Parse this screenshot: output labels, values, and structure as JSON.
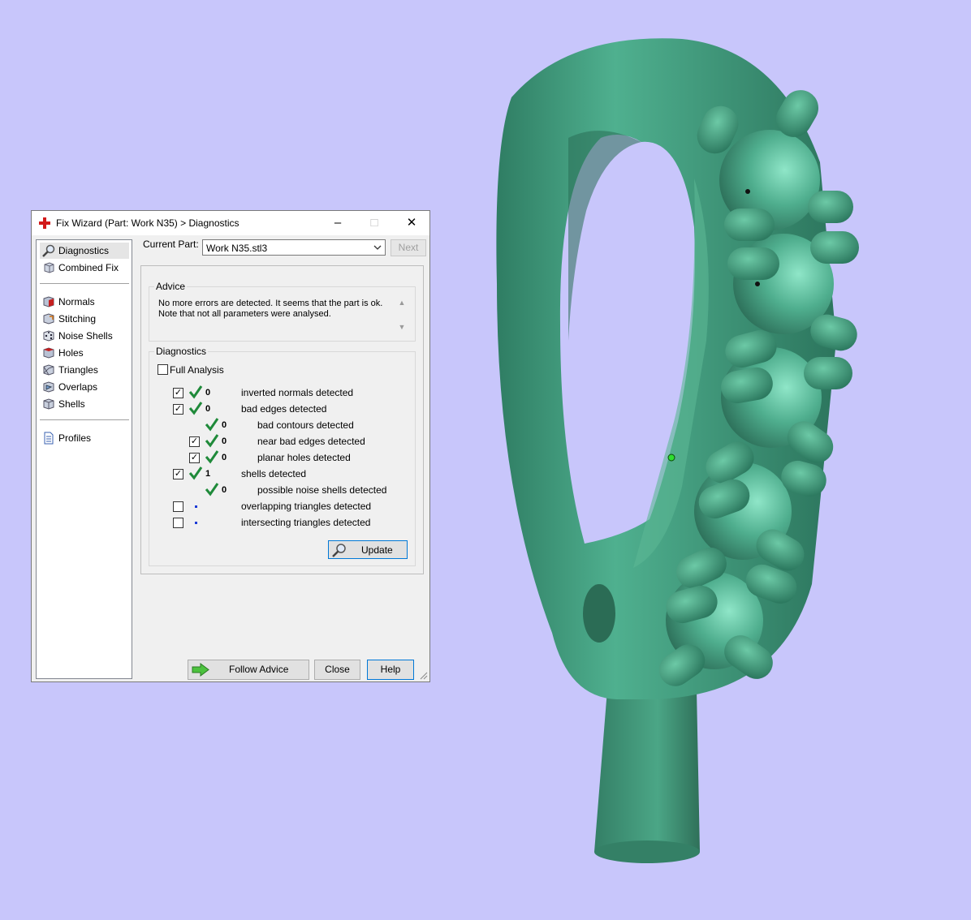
{
  "window": {
    "title": "Fix Wizard (Part: Work N35) > Diagnostics",
    "icon": "red-cross-icon"
  },
  "nav": {
    "items": [
      {
        "label": "Diagnostics",
        "icon": "magnifier-icon",
        "selected": true
      },
      {
        "label": "Combined Fix",
        "icon": "cube-icon"
      },
      {
        "label": "Normals",
        "icon": "normals-cube-icon"
      },
      {
        "label": "Stitching",
        "icon": "stitching-cube-icon"
      },
      {
        "label": "Noise Shells",
        "icon": "dice-icon"
      },
      {
        "label": "Holes",
        "icon": "holes-cube-icon"
      },
      {
        "label": "Triangles",
        "icon": "triangles-cube-icon"
      },
      {
        "label": "Overlaps",
        "icon": "overlaps-cube-icon"
      },
      {
        "label": "Shells",
        "icon": "shells-cube-icon"
      },
      {
        "label": "Profiles",
        "icon": "document-icon"
      }
    ]
  },
  "current_part": {
    "label": "Current Part:",
    "value": "Work N35.stl3",
    "next_label": "Next"
  },
  "advice": {
    "legend": "Advice",
    "line1": "No more errors are detected. It seems that the part is ok.",
    "line2": "Note that not all parameters were analysed."
  },
  "diagnostics": {
    "legend": "Diagnostics",
    "full_analysis_label": "Full Analysis",
    "full_analysis_checked": false,
    "rows": [
      {
        "label": "inverted normals detected",
        "count": "0",
        "checked": true,
        "status": "ok"
      },
      {
        "label": "bad edges detected",
        "count": "0",
        "checked": true,
        "status": "ok"
      },
      {
        "label": "bad contours detected",
        "count": "0",
        "status": "ok"
      },
      {
        "label": "near bad edges detected",
        "count": "0",
        "checked": true,
        "status": "ok"
      },
      {
        "label": "planar holes detected",
        "count": "0",
        "checked": true,
        "status": "ok"
      },
      {
        "label": "shells detected",
        "count": "1",
        "checked": true,
        "status": "ok"
      },
      {
        "label": "possible noise shells detected",
        "count": "0",
        "status": "ok"
      },
      {
        "label": "overlapping triangles detected",
        "count": "",
        "checked": false,
        "status": "not-analysed"
      },
      {
        "label": "intersecting triangles detected",
        "count": "",
        "checked": false,
        "status": "not-analysed"
      }
    ],
    "update_label": "Update"
  },
  "buttons": {
    "follow_advice": "Follow Advice",
    "close": "Close",
    "help": "Help"
  },
  "colors": {
    "viewport_bg": "#c8c6fb",
    "model": "#3f9a7e",
    "check_green": "#1f8a3a"
  }
}
